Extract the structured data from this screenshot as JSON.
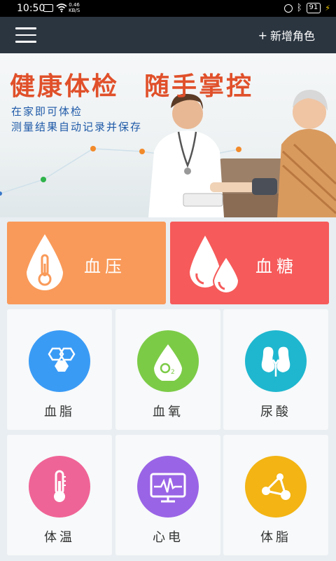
{
  "status_bar": {
    "time": "10:50",
    "net_speed_value": "0.46",
    "net_speed_unit": "KB/S",
    "battery": "91"
  },
  "header": {
    "add_role_label": "新增角色",
    "plus": "+"
  },
  "banner": {
    "title_part1": "健康体检",
    "title_part2": "随手掌控",
    "subtitle_line1": "在家即可体检",
    "subtitle_line2": "测量结果自动记录并保存"
  },
  "tiles": {
    "blood_pressure": {
      "label": "血压",
      "color": "#f99a5a"
    },
    "blood_sugar": {
      "label": "血糖",
      "color": "#f65a5a"
    }
  },
  "cards": [
    {
      "label": "血脂",
      "icon": "hexagon-molecule-icon",
      "color": "#3a9bf5"
    },
    {
      "label": "血氧",
      "icon": "oxygen-drop-icon",
      "color": "#7ccb47"
    },
    {
      "label": "尿酸",
      "icon": "kidney-icon",
      "color": "#1fb7cf"
    },
    {
      "label": "体温",
      "icon": "thermometer-icon",
      "color": "#ef6496"
    },
    {
      "label": "心电",
      "icon": "ecg-monitor-icon",
      "color": "#9a64e6"
    },
    {
      "label": "体脂",
      "icon": "molecule-nodes-icon",
      "color": "#f3b414"
    }
  ]
}
